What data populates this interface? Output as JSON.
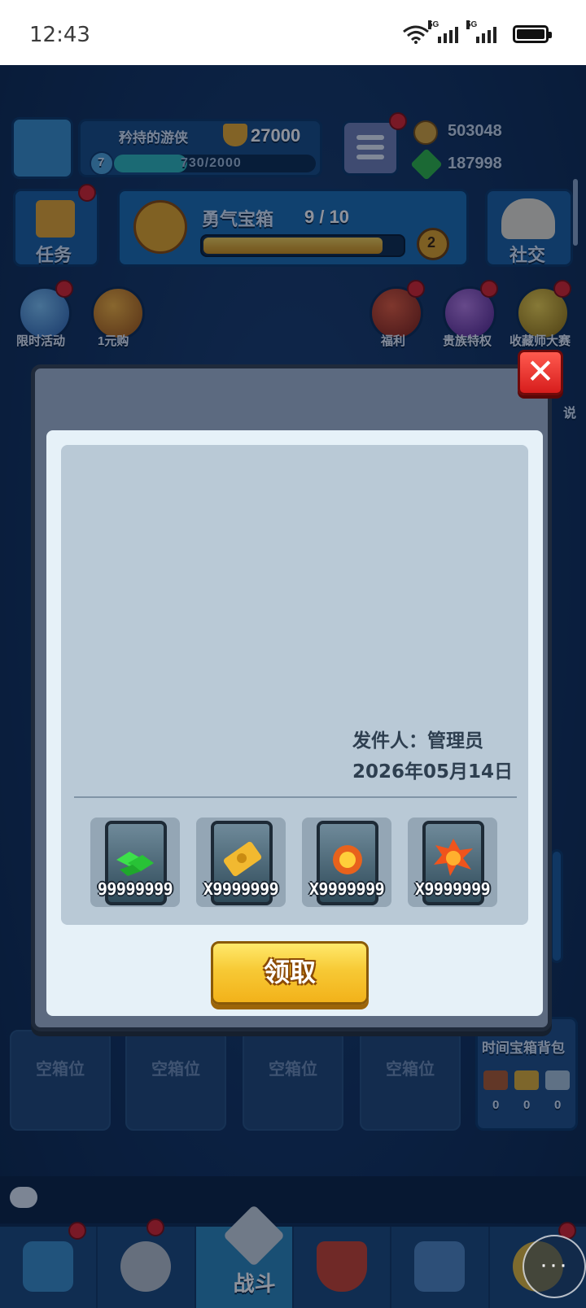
{
  "status_bar": {
    "time": "12:43",
    "network_1": "5G",
    "network_2": "5G"
  },
  "player": {
    "name": "矜持的游侠",
    "level": "7",
    "xp": "730/2000",
    "trophies": "27000",
    "coins": "503048",
    "gems": "187998"
  },
  "top_buttons": {
    "tasks": "任务",
    "social": "社交"
  },
  "chest_progress": {
    "title": "勇气宝箱",
    "progress_text": "9 / 10",
    "progress_fraction": 0.9,
    "count": "2"
  },
  "side_icons": {
    "left": [
      "限时活动",
      "1元购"
    ],
    "right": [
      "福利",
      "贵族特权",
      "收藏师大赛"
    ],
    "partial_label": "说"
  },
  "chest_slots": [
    "空箱位",
    "空箱位",
    "空箱位",
    "空箱位"
  ],
  "timed_chest_bag": {
    "title": "时间宝箱背包",
    "counts": [
      "0",
      "0",
      "0"
    ]
  },
  "bottom_nav": {
    "active_label": "战斗"
  },
  "mail_modal": {
    "sender": "发件人：管理员",
    "date": "2026年05月14日",
    "rewards": [
      {
        "icon": "gems-icon",
        "qty": "99999999"
      },
      {
        "icon": "golden-ticket-icon",
        "qty": "X9999999"
      },
      {
        "icon": "fire-orb-icon",
        "qty": "X9999999"
      },
      {
        "icon": "fire-burst-icon",
        "qty": "X9999999"
      }
    ],
    "claim_label": "领取",
    "close_label": "✕"
  },
  "more_button": "···",
  "colors": {
    "claim_button": "#f7c935",
    "close_button": "#d71d1d",
    "panel_blue": "#1a5fa0"
  }
}
